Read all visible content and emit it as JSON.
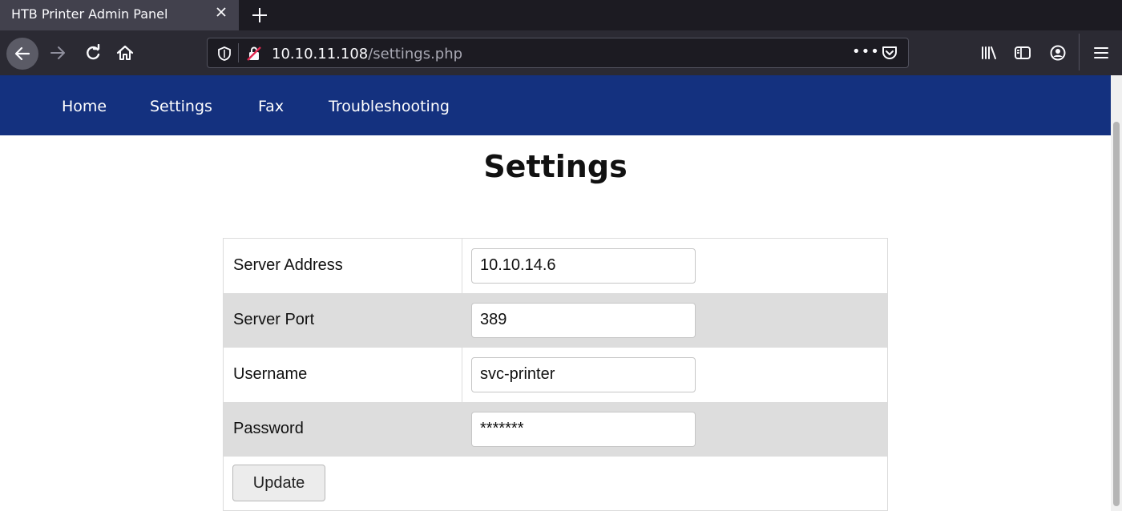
{
  "browser": {
    "tab": {
      "title": "HTB Printer Admin Panel"
    },
    "url": {
      "host": "10.10.11.108",
      "path": "/settings.php"
    },
    "url_actions_label": "•••"
  },
  "site": {
    "nav": [
      {
        "label": "Home"
      },
      {
        "label": "Settings"
      },
      {
        "label": "Fax"
      },
      {
        "label": "Troubleshooting"
      }
    ],
    "title": "Settings",
    "form": {
      "rows": [
        {
          "label": "Server Address",
          "value": "10.10.14.6"
        },
        {
          "label": "Server Port",
          "value": "389"
        },
        {
          "label": "Username",
          "value": "svc-printer"
        },
        {
          "label": "Password",
          "value": "*******"
        }
      ],
      "submit_label": "Update"
    }
  },
  "colors": {
    "site_nav_bg": "#14317f",
    "browser_chrome": "#2b2a33",
    "tabbar": "#1c1b22",
    "row_shade": "#dddddd"
  },
  "icons": [
    "close-icon",
    "plus-icon",
    "back-arrow-icon",
    "forward-arrow-icon",
    "reload-icon",
    "home-icon",
    "shield-icon",
    "insecure-lock-icon",
    "more-dots-icon",
    "pocket-icon",
    "library-icon",
    "sidebar-icon",
    "account-icon",
    "hamburger-menu-icon"
  ]
}
